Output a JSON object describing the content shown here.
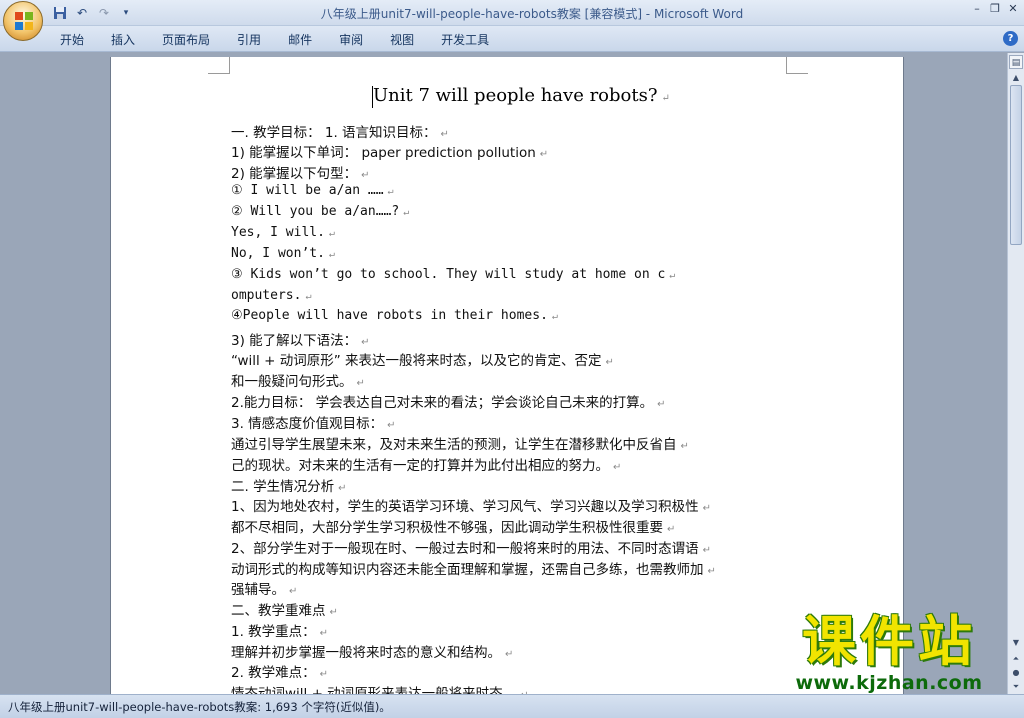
{
  "window": {
    "title": "八年级上册unit7-will-people-have-robots教案 [兼容模式] - Microsoft Word",
    "controls": [
      "minimize",
      "restore",
      "close"
    ]
  },
  "quick_access": [
    "save-icon",
    "undo-icon",
    "redo-icon",
    "customize-icon"
  ],
  "ribbon": {
    "tabs": [
      "开始",
      "插入",
      "页面布局",
      "引用",
      "邮件",
      "审阅",
      "视图",
      "开发工具"
    ]
  },
  "document": {
    "title": "Unit 7 will people have robots?",
    "lines": [
      "一. 教学目标：    1.  语言知识目标：",
      "1)  能掌握以下单词：   paper  prediction   pollution",
      "2)  能掌握以下句型：",
      "①  I will be a/an ……",
      "②  Will you be a/an……?",
      "  Yes, I will.",
      "  No, I won’t.",
      "③  Kids  won’t  go  to  school.  They  will  study  at  home  on  c",
      "omputers.",
      "④People will have robots in their homes.",
      "3)  能了解以下语法：",
      "     “will  +  动词原形”    来表达一般将来时态，以及它的肯定、否定",
      "和一般疑问句形式。",
      "2.能力目标：   学会表达自己对未来的看法；学会谈论自己未来的打算。",
      "3.  情感态度价值观目标：",
      "  通过引导学生展望未来，及对未来生活的预测，让学生在潜移默化中反省自",
      "己的现状。对未来的生活有一定的打算并为此付出相应的努力。",
      "二. 学生情况分析",
      "1、因为地处农村，学生的英语学习环境、学习风气、学习兴趣以及学习积极性",
      "都不尽相同，大部分学生学习积极性不够强，因此调动学生积极性很重要",
      "2、部分学生对于一般现在时、一般过去时和一般将来时的用法、不同时态谓语",
      "动词形式的构成等知识内容还未能全面理解和掌握，还需自己多练，也需教师加",
      "强辅导。",
      "二、教学重难点",
      "1.  教学重点：",
      "  理解并初步掌握一般将来时态的意义和结构。",
      "2.  教学难点：",
      "  情态动词will  +  动词原形来表达一般将来时态。"
    ]
  },
  "statusbar": {
    "text": "八年级上册unit7-will-people-have-robots教案: 1,693 个字符(近似值)。"
  },
  "watermark": {
    "title": "课件站",
    "url": "www.kjzhan.com"
  },
  "colors": {
    "title_text": "#3b5a8a",
    "watermark_yellow": "#f1e400",
    "watermark_green": "#0d6a0b"
  }
}
